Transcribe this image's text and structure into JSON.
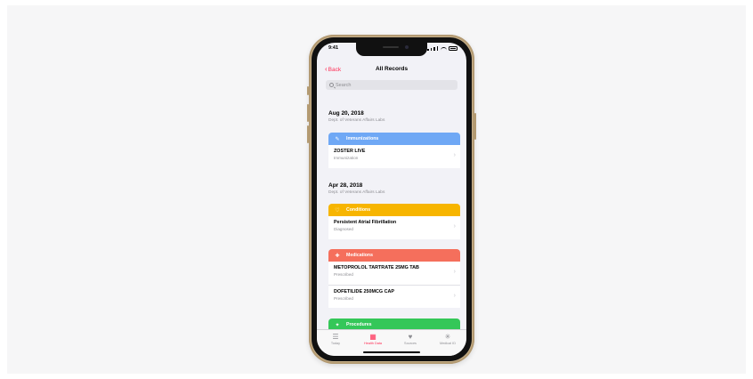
{
  "status_bar": {
    "time": "9:41"
  },
  "nav": {
    "back_label": "Back",
    "title": "All Records"
  },
  "search": {
    "placeholder": "Search"
  },
  "sections": [
    {
      "date": "Aug 20, 2018",
      "subtitle": "Dept. of Veterans Affairs Labs",
      "categories": [
        {
          "name": "Immunizations",
          "icon": "syringe-icon",
          "color": "#6fa8f5",
          "rows": [
            {
              "title": "ZOSTER LIVE",
              "subtitle": "Immunization"
            }
          ]
        }
      ]
    },
    {
      "date": "Apr 28, 2018",
      "subtitle": "Dept. of Veterans Affairs Labs",
      "categories": [
        {
          "name": "Conditions",
          "icon": "stethoscope-icon",
          "color": "#f7b500",
          "rows": [
            {
              "title": "Persistent Atrial Fibrillation",
              "subtitle": "Diagnosed"
            }
          ]
        },
        {
          "name": "Medications",
          "icon": "pill-icon",
          "color": "#f56f5c",
          "rows": [
            {
              "title": "METOPROLOL TARTRATE 25MG TAB",
              "subtitle": "Prescribed"
            },
            {
              "title": "DOFETILIDE 250MCG CAP",
              "subtitle": "Prescribed"
            }
          ]
        },
        {
          "name": "Procedures",
          "icon": "procedure-icon",
          "color": "#34c759",
          "rows": []
        }
      ]
    }
  ],
  "tabbar": {
    "tabs": [
      {
        "label": "Today",
        "icon": "today-icon",
        "active": false
      },
      {
        "label": "Health Data",
        "icon": "health-data-icon",
        "active": true
      },
      {
        "label": "Sources",
        "icon": "sources-icon",
        "active": false
      },
      {
        "label": "Medical ID",
        "icon": "medical-id-icon",
        "active": false
      }
    ]
  },
  "colors": {
    "accent": "#ff2d55"
  }
}
